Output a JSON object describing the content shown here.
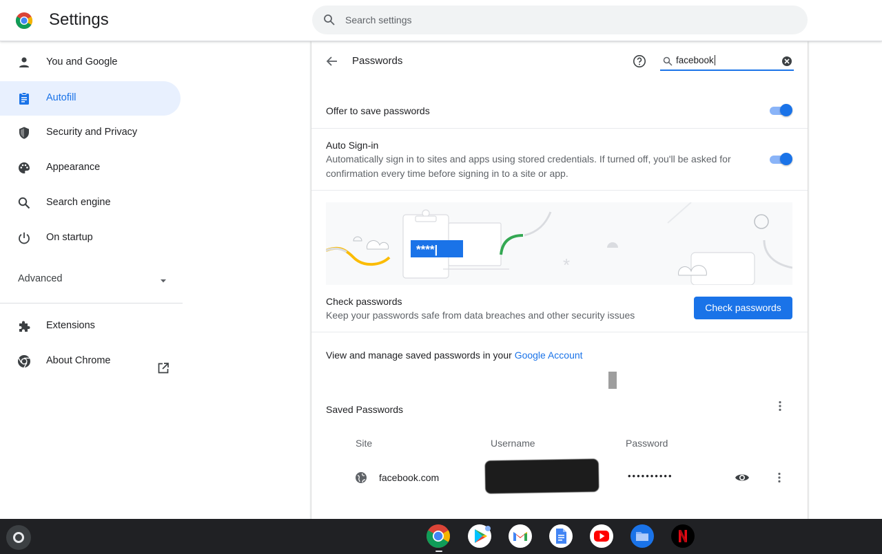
{
  "header": {
    "title": "Settings",
    "search_placeholder": "Search settings"
  },
  "sidebar": {
    "items": [
      {
        "label": "You and Google",
        "icon": "person-icon"
      },
      {
        "label": "Autofill",
        "icon": "clipboard-icon",
        "active": true
      },
      {
        "label": "Security and Privacy",
        "icon": "shield-icon"
      },
      {
        "label": "Appearance",
        "icon": "palette-icon"
      },
      {
        "label": "Search engine",
        "icon": "search-icon"
      },
      {
        "label": "On startup",
        "icon": "power-icon"
      }
    ],
    "advanced_label": "Advanced",
    "extensions_label": "Extensions",
    "about_label": "About Chrome"
  },
  "passwords": {
    "title": "Passwords",
    "search_value": "facebook",
    "offer_to_save_label": "Offer to save passwords",
    "offer_to_save_enabled": true,
    "auto_signin_label": "Auto Sign-in",
    "auto_signin_desc_line1": "Automatically sign in to sites and apps using stored credentials. If turned off, you'll be asked for",
    "auto_signin_desc_line2": "confirmation every time before signing in to a site or app.",
    "auto_signin_enabled": true,
    "illustration_text": "****|",
    "check_title": "Check passwords",
    "check_desc": "Keep your passwords safe from data breaches and other security issues",
    "check_button": "Check passwords",
    "manage_text": "View and manage saved passwords in your ",
    "manage_link": "Google Account",
    "saved_title": "Saved Passwords",
    "columns": {
      "site": "Site",
      "username": "Username",
      "password": "Password"
    },
    "entries": [
      {
        "site": "facebook.com",
        "username": "",
        "password": "••••••••••"
      }
    ]
  },
  "colors": {
    "accent": "#1a73e8",
    "accent_light": "#e8f0fe",
    "shelf": "#202124"
  },
  "shelf": {
    "apps": [
      "chrome-icon",
      "play-store-icon",
      "gmail-icon",
      "docs-icon",
      "youtube-icon",
      "files-icon",
      "netflix-icon"
    ]
  }
}
